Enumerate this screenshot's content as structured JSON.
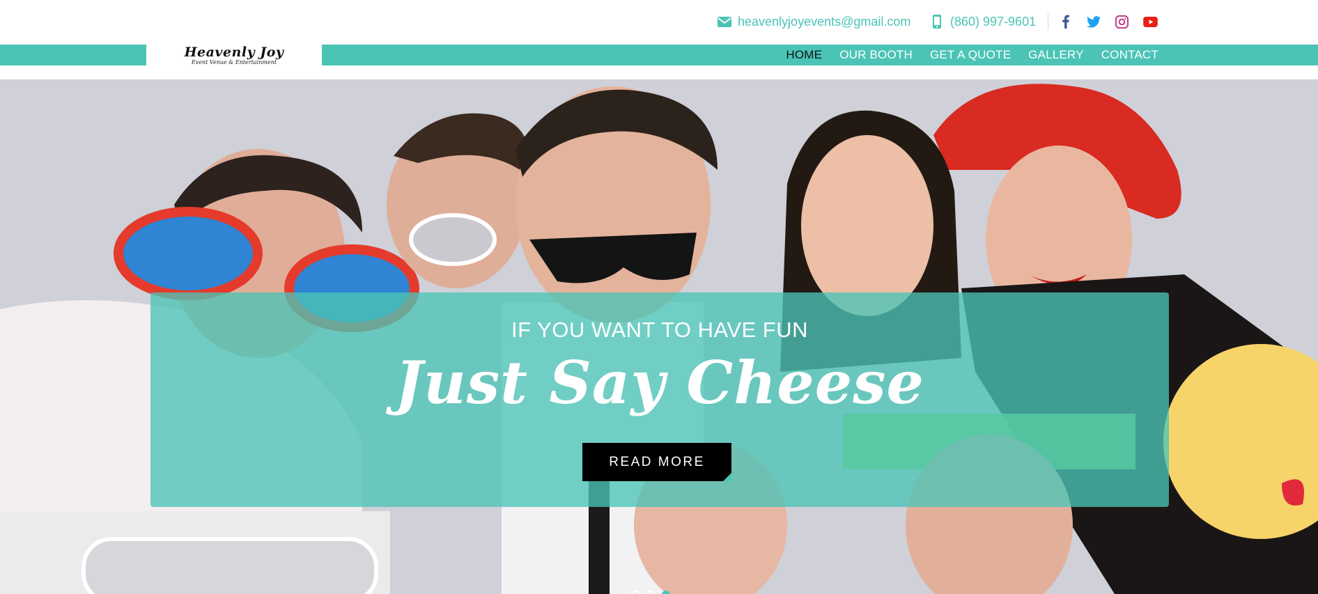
{
  "header": {
    "email": "heavenlyjoyevents@gmail.com",
    "phone": "(860) 997-9601",
    "social": [
      {
        "name": "facebook-icon",
        "color": "#3b5998"
      },
      {
        "name": "twitter-icon",
        "color": "#1da1f2"
      },
      {
        "name": "instagram-icon",
        "color": "#c13584"
      },
      {
        "name": "youtube-icon",
        "color": "#e62117"
      }
    ]
  },
  "logo": {
    "title": "Heavenly Joy",
    "subtitle": "Event Venue & Entertainment"
  },
  "nav": {
    "items": [
      {
        "label": "HOME",
        "active": true
      },
      {
        "label": "OUR BOOTH",
        "active": false
      },
      {
        "label": "GET A QUOTE",
        "active": false
      },
      {
        "label": "GALLERY",
        "active": false
      },
      {
        "label": "CONTACT",
        "active": false
      }
    ]
  },
  "hero": {
    "kicker": "IF YOU WANT TO HAVE FUN",
    "title": "Just Say Cheese",
    "cta_label": "READ MORE",
    "slides": 3,
    "active_slide": 3
  },
  "colors": {
    "accent": "#4bc4b6",
    "text_dark": "#111111",
    "button_bg": "#000000"
  }
}
